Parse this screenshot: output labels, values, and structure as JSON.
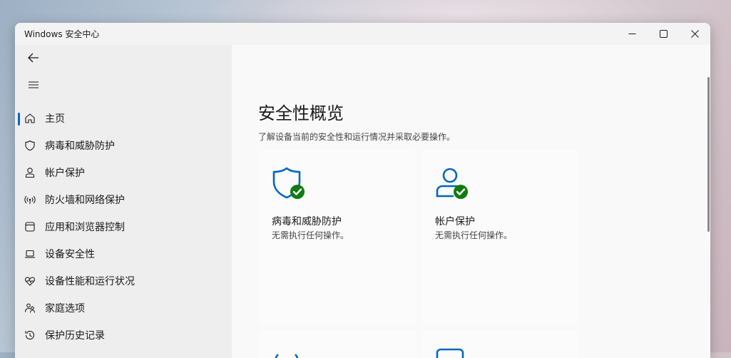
{
  "window": {
    "title": "Windows 安全中心",
    "minimize_icon": "minimize-icon",
    "maximize_icon": "maximize-icon",
    "close_icon": "close-icon"
  },
  "sidebar": {
    "back_icon": "back-arrow-icon",
    "menu_icon": "hamburger-menu-icon",
    "items": [
      {
        "label": "主页",
        "icon": "home-icon",
        "selected": true
      },
      {
        "label": "病毒和威胁防护",
        "icon": "shield-icon"
      },
      {
        "label": "帐户保护",
        "icon": "person-icon"
      },
      {
        "label": "防火墙和网络保护",
        "icon": "wireless-signal-icon"
      },
      {
        "label": "应用和浏览器控制",
        "icon": "app-window-icon"
      },
      {
        "label": "设备安全性",
        "icon": "laptop-icon"
      },
      {
        "label": "设备性能和运行状况",
        "icon": "heart-pulse-icon"
      },
      {
        "label": "家庭选项",
        "icon": "family-icon"
      },
      {
        "label": "保护历史记录",
        "icon": "history-icon"
      }
    ]
  },
  "main": {
    "title": "安全性概览",
    "subtitle": "了解设备当前的安全性和运行情况并采取必要操作。",
    "cards": [
      {
        "title": "病毒和威胁防护",
        "status": "无需执行任何操作。",
        "icon": "shield-check-icon"
      },
      {
        "title": "帐户保护",
        "status": "无需执行任何操作。",
        "icon": "account-check-icon"
      }
    ]
  },
  "colors": {
    "accent": "#0067c0",
    "ok_green": "#107c10"
  }
}
